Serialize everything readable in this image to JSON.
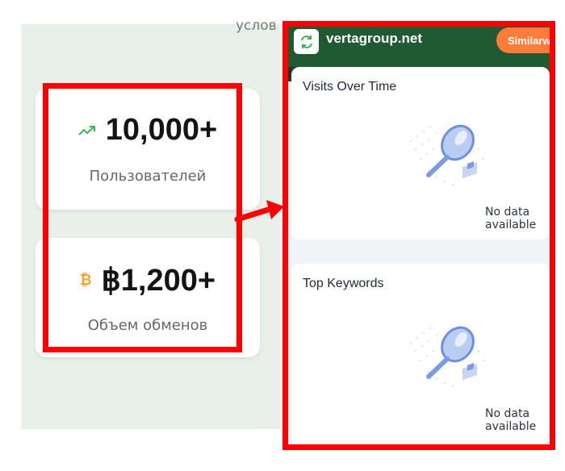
{
  "background": {
    "partial_text": "услов"
  },
  "stats": [
    {
      "value": "10,000+",
      "label": "Пользователей",
      "icon": "trending-up-icon"
    },
    {
      "value": "฿1,200+",
      "label": "Объем обменов",
      "icon": "bitcoin-icon",
      "icon_glyph": "₿"
    }
  ],
  "widget": {
    "site": "vertagroup.net",
    "button_label": "Similarw",
    "sections": [
      {
        "title": "Visits Over Time",
        "empty_text": "No data available"
      },
      {
        "title": "Top Keywords",
        "empty_text": "No data available"
      }
    ]
  },
  "colors": {
    "highlight": "#ff0000",
    "header_green": "#205a32",
    "accent_orange": "#ff7c3b",
    "trend_green": "#3bb35a",
    "bitcoin_orange": "#f7a12b"
  }
}
